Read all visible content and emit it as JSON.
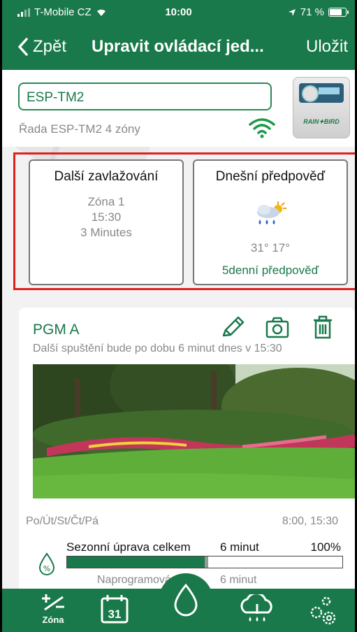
{
  "status_bar": {
    "carrier": "T-Mobile CZ",
    "time": "10:00",
    "battery": "71 %"
  },
  "nav": {
    "back": "Zpět",
    "title": "Upravit ovládací jed...",
    "save": "Uložit"
  },
  "controller": {
    "name": "ESP-TM2",
    "subtitle": "Řada ESP-TM2  4 zóny",
    "device_brand": "RAIN✦BIRD"
  },
  "next_watering": {
    "title": "Další zavlažování",
    "zone": "Zóna 1",
    "time": "15:30",
    "duration": "3 Minutes"
  },
  "forecast": {
    "title": "Dnešní předpověď",
    "temps": "31° 17°",
    "link": "5denní předpověď",
    "icon": "rain-sun-icon"
  },
  "program": {
    "name": "PGM A",
    "next_run": "Další spuštění bude po dobu 6 minut dnes v 15:30",
    "days": "Po/Út/St/Čt/Pá",
    "times": "8:00, 15:30",
    "seasonal_label": "Sezonní úprava celkem",
    "seasonal_minutes": "6 minut",
    "seasonal_percent": "100%",
    "seasonal_fraction": 1.0,
    "programmed_label": "Naprogramováno",
    "programmed_minutes": "6 minut"
  },
  "tabs": {
    "zone_label": "Zóna",
    "calendar_day": "31"
  },
  "colors": {
    "brand_green": "#19794a",
    "highlight_red": "#e0201f"
  }
}
